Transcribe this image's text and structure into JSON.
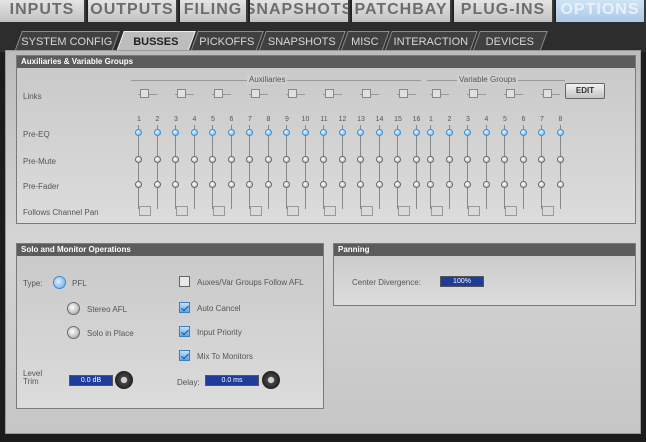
{
  "top_tabs": [
    "INPUTS",
    "OUTPUTS",
    "FILING",
    "SNAPSHOTS",
    "PATCHBAY",
    "PLUG-INS",
    "OPTIONS"
  ],
  "sub_tabs": [
    "SYSTEM CONFIG",
    "BUSSES",
    "PICKOFFS",
    "SNAPSHOTS",
    "MISC",
    "INTERACTION",
    "DEVICES"
  ],
  "aux_panel": {
    "title": "Auxiliaries & Variable Groups",
    "auxiliaries_label": "Auxiliaries",
    "vgroups_label": "Variable Groups",
    "edit": "EDIT",
    "rows": [
      "Links",
      "Pre-EQ",
      "Pre-Mute",
      "Pre-Fader",
      "Follows Channel Pan"
    ],
    "aux_numbers": [
      "1",
      "2",
      "3",
      "4",
      "5",
      "6",
      "7",
      "8",
      "9",
      "10",
      "11",
      "12",
      "13",
      "14",
      "15",
      "16"
    ],
    "vg_numbers": [
      "1",
      "2",
      "3",
      "4",
      "5",
      "6",
      "7",
      "8"
    ]
  },
  "solo_panel": {
    "title": "Solo and Monitor Operations",
    "type_label": "Type:",
    "radios": [
      "PFL",
      "Stereo AFL",
      "Solo in Place"
    ],
    "checks": [
      "Auxes/Var Groups Follow AFL",
      "Auto Cancel",
      "Input Priority",
      "Mix To Monitors"
    ],
    "checks_on": [
      false,
      true,
      true,
      true
    ],
    "level_trim_label": "Level\nTrim",
    "level_trim_value": "0.0 dB",
    "delay_label": "Delay:",
    "delay_value": "0.0 ms"
  },
  "panning_panel": {
    "title": "Panning",
    "center_divergence_label": "Center Divergence:",
    "center_divergence_value": "100%"
  }
}
